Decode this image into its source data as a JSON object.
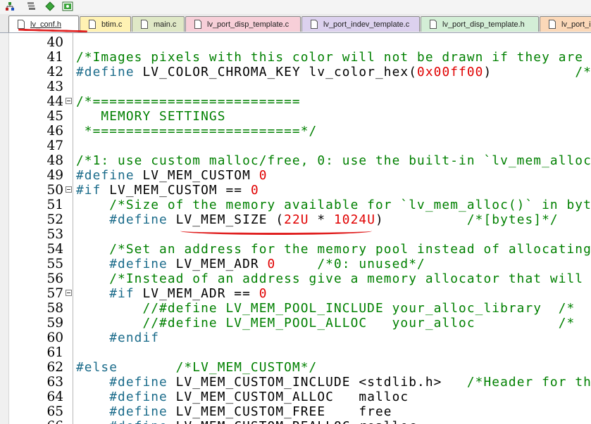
{
  "toolbar": {
    "icons": [
      "build-tree-icon",
      "layers-icon",
      "diamond-icon",
      "config-icon"
    ]
  },
  "tabs": [
    {
      "label": "lv_conf.h",
      "active": true,
      "color": "#ffffff"
    },
    {
      "label": "btim.c",
      "active": false,
      "color": "#fff2b3"
    },
    {
      "label": "main.c",
      "active": false,
      "color": "#dfe8c6"
    },
    {
      "label": "lv_port_disp_template.c",
      "active": false,
      "color": "#f7cfd8"
    },
    {
      "label": "lv_port_indev_template.c",
      "active": false,
      "color": "#dcd1ee"
    },
    {
      "label": "lv_port_disp_template.h",
      "active": false,
      "color": "#d3eed6"
    },
    {
      "label": "lv_port_i",
      "active": false,
      "color": "#fbd8b8"
    }
  ],
  "annotation_color": "#e02020",
  "editor": {
    "lines": [
      {
        "n": "40",
        "fold": false,
        "parts": []
      },
      {
        "n": "41",
        "fold": false,
        "parts": [
          {
            "t": "/*Images pixels with this color will not be drawn if they are",
            "c": "cm"
          }
        ]
      },
      {
        "n": "42",
        "fold": false,
        "parts": [
          {
            "t": "#define ",
            "c": "pp"
          },
          {
            "t": "LV_COLOR_CHROMA_KEY lv_color_hex(",
            "c": "tx"
          },
          {
            "t": "0x00ff00",
            "c": "nm"
          },
          {
            "t": ")          ",
            "c": "tx"
          },
          {
            "t": "/*",
            "c": "cm"
          }
        ]
      },
      {
        "n": "43",
        "fold": false,
        "parts": []
      },
      {
        "n": "44",
        "fold": true,
        "parts": [
          {
            "t": "/*=========================",
            "c": "cm"
          }
        ]
      },
      {
        "n": "45",
        "fold": false,
        "parts": [
          {
            "t": "   MEMORY SETTINGS",
            "c": "cm"
          }
        ]
      },
      {
        "n": "46",
        "fold": false,
        "parts": [
          {
            "t": " *=========================*/",
            "c": "cm"
          }
        ]
      },
      {
        "n": "47",
        "fold": false,
        "parts": []
      },
      {
        "n": "48",
        "fold": false,
        "parts": [
          {
            "t": "/*1: use custom malloc/free, 0: use the built-in `lv_mem_alloc",
            "c": "cm"
          }
        ]
      },
      {
        "n": "49",
        "fold": false,
        "parts": [
          {
            "t": "#define ",
            "c": "pp"
          },
          {
            "t": "LV_MEM_CUSTOM ",
            "c": "tx"
          },
          {
            "t": "0",
            "c": "nm"
          }
        ]
      },
      {
        "n": "50",
        "fold": true,
        "parts": [
          {
            "t": "#if ",
            "c": "pp"
          },
          {
            "t": "LV_MEM_CUSTOM == ",
            "c": "tx"
          },
          {
            "t": "0",
            "c": "nm"
          }
        ]
      },
      {
        "n": "51",
        "fold": false,
        "parts": [
          {
            "t": "    /*Size of the memory available for `lv_mem_alloc()` in bytes",
            "c": "cm"
          }
        ]
      },
      {
        "n": "52",
        "fold": false,
        "parts": [
          {
            "t": "    #define ",
            "c": "pp"
          },
          {
            "t": "LV_MEM_SIZE (",
            "c": "tx"
          },
          {
            "t": "22U",
            "c": "nm"
          },
          {
            "t": " * ",
            "c": "tx"
          },
          {
            "t": "1024U",
            "c": "nm"
          },
          {
            "t": ")          ",
            "c": "tx"
          },
          {
            "t": "/*[bytes]*/",
            "c": "cm"
          }
        ]
      },
      {
        "n": "53",
        "fold": false,
        "parts": []
      },
      {
        "n": "54",
        "fold": false,
        "parts": [
          {
            "t": "    /*Set an address for the memory pool instead of allocating",
            "c": "cm"
          }
        ]
      },
      {
        "n": "55",
        "fold": false,
        "parts": [
          {
            "t": "    #define ",
            "c": "pp"
          },
          {
            "t": "LV_MEM_ADR ",
            "c": "tx"
          },
          {
            "t": "0",
            "c": "nm"
          },
          {
            "t": "     ",
            "c": "tx"
          },
          {
            "t": "/*0: unused*/",
            "c": "cm"
          }
        ]
      },
      {
        "n": "56",
        "fold": false,
        "parts": [
          {
            "t": "    /*Instead of an address give a memory allocator that will",
            "c": "cm"
          }
        ]
      },
      {
        "n": "57",
        "fold": true,
        "parts": [
          {
            "t": "    #if ",
            "c": "pp"
          },
          {
            "t": "LV_MEM_ADR == ",
            "c": "tx"
          },
          {
            "t": "0",
            "c": "nm"
          }
        ]
      },
      {
        "n": "58",
        "fold": false,
        "parts": [
          {
            "t": "        //#define LV_MEM_POOL_INCLUDE your_alloc_library  /* ",
            "c": "cm"
          }
        ]
      },
      {
        "n": "59",
        "fold": false,
        "parts": [
          {
            "t": "        //#define LV_MEM_POOL_ALLOC   your_alloc          /* ",
            "c": "cm"
          }
        ]
      },
      {
        "n": "60",
        "fold": false,
        "parts": [
          {
            "t": "    #endif",
            "c": "pp"
          }
        ]
      },
      {
        "n": "61",
        "fold": false,
        "parts": []
      },
      {
        "n": "62",
        "fold": false,
        "parts": [
          {
            "t": "#else",
            "c": "pp"
          },
          {
            "t": "       ",
            "c": "tx"
          },
          {
            "t": "/*LV_MEM_CUSTOM*/",
            "c": "cm"
          }
        ]
      },
      {
        "n": "63",
        "fold": false,
        "parts": [
          {
            "t": "    #define ",
            "c": "pp"
          },
          {
            "t": "LV_MEM_CUSTOM_INCLUDE <stdlib.h>   ",
            "c": "tx"
          },
          {
            "t": "/*Header for the",
            "c": "cm"
          }
        ]
      },
      {
        "n": "64",
        "fold": false,
        "parts": [
          {
            "t": "    #define ",
            "c": "pp"
          },
          {
            "t": "LV_MEM_CUSTOM_ALLOC   malloc",
            "c": "tx"
          }
        ]
      },
      {
        "n": "65",
        "fold": false,
        "parts": [
          {
            "t": "    #define ",
            "c": "pp"
          },
          {
            "t": "LV_MEM_CUSTOM_FREE    free",
            "c": "tx"
          }
        ]
      },
      {
        "n": "66",
        "fold": false,
        "parts": [
          {
            "t": "    #define ",
            "c": "pp"
          },
          {
            "t": "LV_MEM_CUSTOM_REALLOC realloc",
            "c": "tx"
          }
        ]
      }
    ]
  }
}
